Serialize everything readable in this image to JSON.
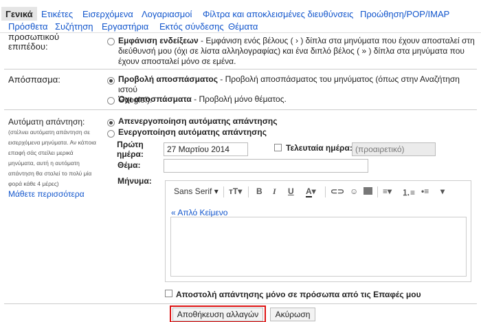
{
  "tabs": [
    {
      "label": "Γενικά"
    },
    {
      "label": "Ετικέτες"
    },
    {
      "label": "Εισερχόμενα"
    },
    {
      "label": "Λογαριασμοί"
    },
    {
      "label": "Φίλτρα και αποκλεισμένες διευθύνσεις"
    },
    {
      "label": "Προώθηση/POP/IMAP"
    },
    {
      "label": "Πρόσθετα"
    },
    {
      "label": "Συζήτηση"
    },
    {
      "label": "Εργαστήρια"
    },
    {
      "label": "Εκτός σύνδεσης"
    },
    {
      "label": "Θέματα"
    }
  ],
  "personal_level": {
    "label_line1": "προσωπικού",
    "label_line2": "επιπέδου:",
    "option_bold": "Εμφάνιση ενδείξεων",
    "option_rest_line1": " - Εμφάνιση ενός βέλους ( › ) δίπλα στα μηνύματα που έχουν αποσταλεί στη",
    "option_line2": "διεύθυνσή μου (όχι σε λίστα αλληλογραφίας) και ένα διπλό βέλος ( » ) δίπλα στα μηνύματα που",
    "option_line3": "έχουν αποσταλεί μόνο σε εμένα."
  },
  "snippets": {
    "label": "Απόσπασμα:",
    "opt1_bold": "Προβολή αποσπάσματος",
    "opt1_rest": " - Προβολή αποσπάσματος του μηνύματος (όπως στην Αναζήτηση ιστού",
    "opt1_line2": "Google!).",
    "opt2_bold": "Όχι αποσπάσματα",
    "opt2_rest": " - Προβολή μόνο θέματος."
  },
  "auto_reply": {
    "label": "Αυτόματη απάντηση:",
    "note": [
      "(στέλνει αυτόματη απάντηση σε",
      "εισερχόμενα μηνύματα. Αν κάποια",
      "επαφή σάς στείλει μερικά",
      "μηνύματα, αυτή η αυτόματη",
      "απάντηση θα σταλεί το πολύ μία",
      "φορά κάθε 4 μέρες)"
    ],
    "learn_more": "Μάθετε περισσότερα",
    "off_label": "Απενεργοποίηση αυτόματης απάντησης",
    "on_label": "Ενεργοποίηση αυτόματης απάντησης",
    "first_day_line1": "Πρώτη",
    "first_day_line2": "ημέρα:",
    "first_day_value": "27 Μαρτίου 2014",
    "last_day_label": "Τελευταία ημέρα:",
    "last_day_placeholder": "(προαιρετικό)",
    "subject_label": "Θέμα:",
    "subject_value": "",
    "message_label": "Μήνυμα:",
    "font_name": "Sans Serif",
    "plain_text_link": "« Απλό Κείμενο",
    "contacts_only_label": "Αποστολή απάντησης μόνο σε πρόσωπα από τις Επαφές μου"
  },
  "toolbar_icons": [
    "font-size-icon",
    "bold-icon",
    "italic-icon",
    "underline-icon",
    "text-color-icon",
    "link-icon",
    "image-icon",
    "align-icon",
    "numbered-list-icon",
    "bulleted-list-icon"
  ],
  "footer": {
    "save_label": "Αποθήκευση αλλαγών",
    "cancel_label": "Ακύρωση"
  },
  "colors": {
    "link": "#1155cc",
    "highlight": "#dd1111"
  }
}
